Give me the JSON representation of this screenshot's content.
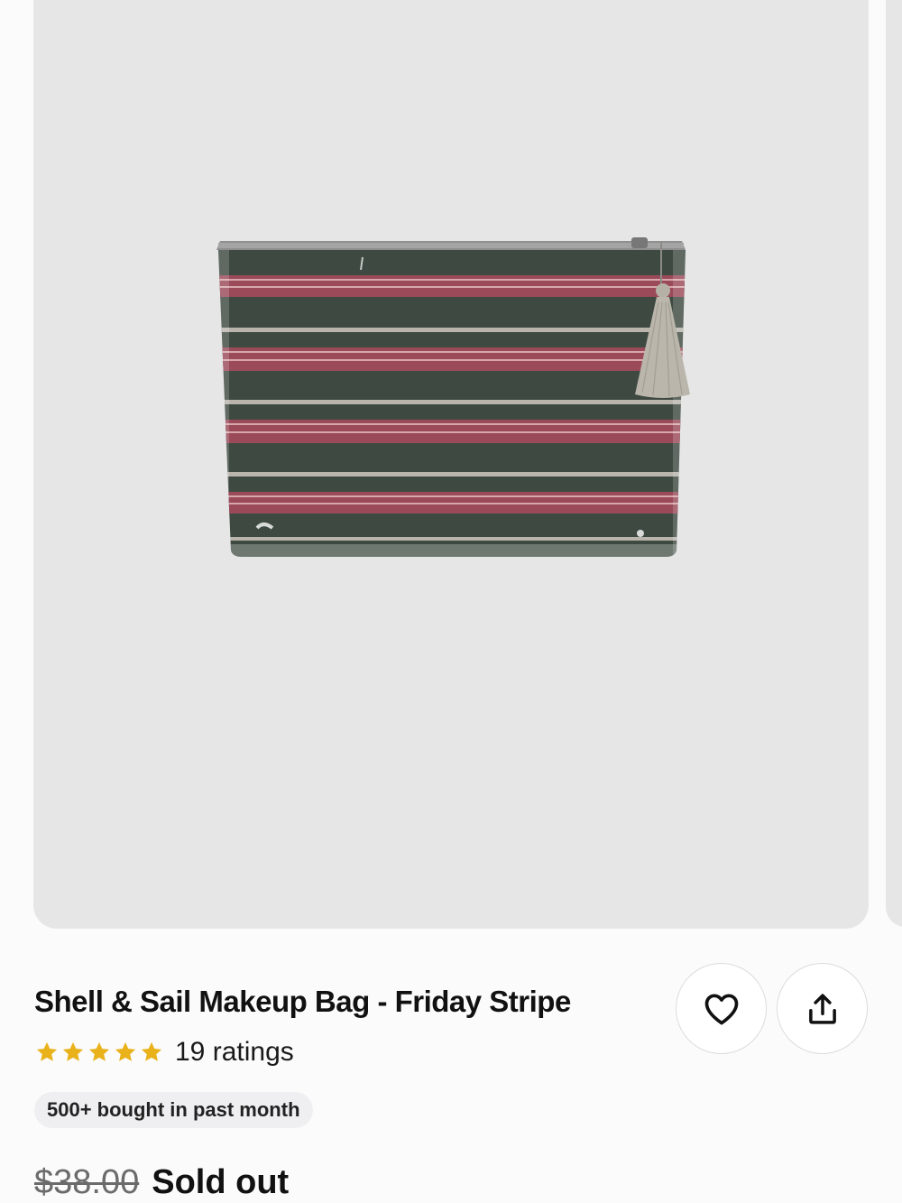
{
  "product": {
    "title": "Shell & Sail Makeup Bag - Friday Stripe",
    "rating_value": 5,
    "rating_max": 5,
    "ratings_text": "19 ratings",
    "badge": "500+ bought in past month",
    "original_price": "$38.00",
    "status": "Sold out"
  },
  "colors": {
    "star": "#e9b21b",
    "image_bg": "#e6e6e7",
    "bag_green": "#3e4a41",
    "bag_red": "#9a4a58",
    "bag_stripe_light": "#b9b5ad"
  },
  "icons": {
    "favorite": "heart-icon",
    "share": "share-icon",
    "rating": "star-icon"
  }
}
